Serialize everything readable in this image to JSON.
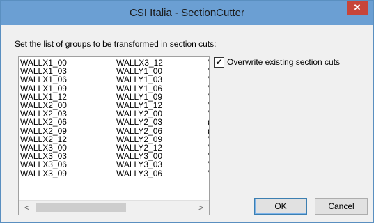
{
  "window": {
    "title": "CSI Italia - SectionCutter",
    "close_glyph": "✕"
  },
  "dialog": {
    "instruction": "Set the list of groups to be transformed in section cuts:",
    "list_col1": [
      "WALLX1_00",
      "WALLX1_03",
      "WALLX1_06",
      "WALLX1_09",
      "WALLX1_12",
      "WALLX2_00",
      "WALLX2_03",
      "WALLX2_06",
      "WALLX2_09",
      "WALLX2_12",
      "WALLX3_00",
      "WALLX3_03",
      "WALLX3_06",
      "WALLX3_09"
    ],
    "list_col2": [
      "WALLX3_12",
      "WALLY1_00",
      "WALLY1_03",
      "WALLY1_06",
      "WALLY1_09",
      "WALLY1_12",
      "WALLY2_00",
      "WALLY2_03",
      "WALLY2_06",
      "WALLY2_09",
      "WALLY2_12",
      "WALLY3_00",
      "WALLY3_03",
      "WALLY3_06"
    ],
    "list_col3_glyphs": [
      "'",
      "'",
      "'",
      "'",
      "'",
      "'",
      "'",
      "(",
      "(",
      "'",
      "'",
      "'",
      "'",
      "'"
    ],
    "scroll_left": "<",
    "scroll_right": ">",
    "overwrite_label": "Overwrite existing section cuts",
    "overwrite_checked": true,
    "check_glyph": "✔",
    "ok_label": "OK",
    "cancel_label": "Cancel"
  }
}
